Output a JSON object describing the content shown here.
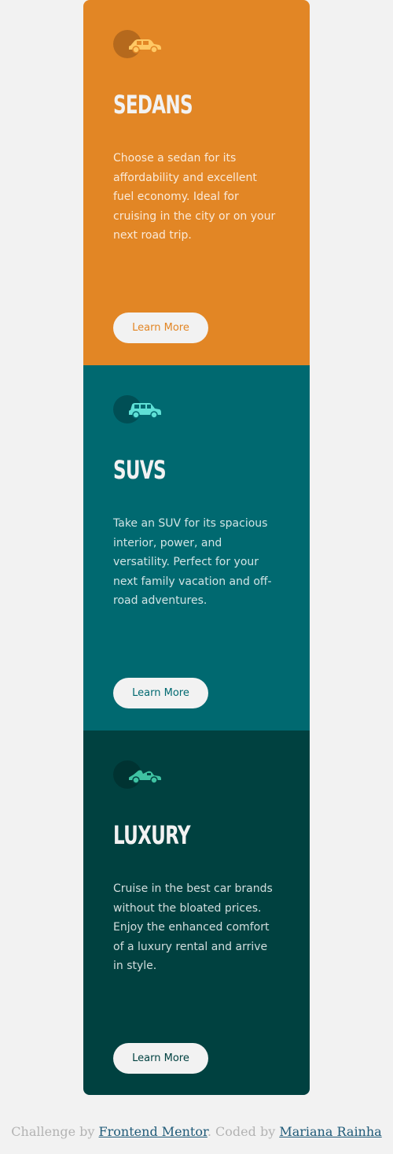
{
  "cards": [
    {
      "title": "Sedans",
      "description": "Choose a sedan for its affordability and excellent fuel economy. Ideal for cruising in the city or on your next road trip.",
      "button_label": "Learn More",
      "icon": "sedan-car-icon",
      "color": "#e28625"
    },
    {
      "title": "SUVs",
      "description": "Take an SUV for its spacious interior, power, and versatility. Perfect for your next family vacation and off-road adventures.",
      "button_label": "Learn More",
      "icon": "suv-car-icon",
      "color": "#006970"
    },
    {
      "title": "Luxury",
      "description": "Cruise in the best car brands without the bloated prices. Enjoy the enhanced comfort of a luxury rental and arrive in style.",
      "button_label": "Learn More",
      "icon": "luxury-car-icon",
      "color": "#004140"
    }
  ],
  "attribution": {
    "prefix": "Challenge by ",
    "link1": "Frontend Mentor",
    "middle": ". Coded by ",
    "link2": "Mariana Rainha"
  }
}
